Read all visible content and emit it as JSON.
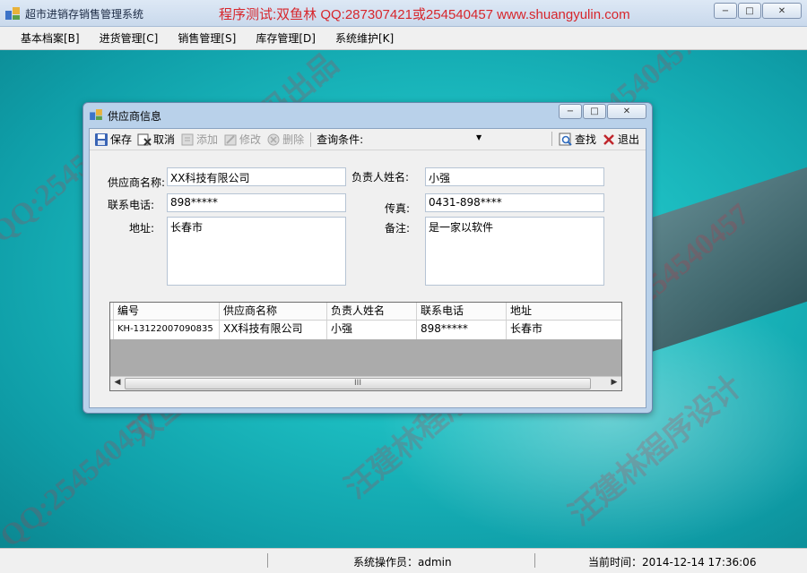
{
  "app": {
    "title": "超市进销存销售管理系统",
    "banner": "程序测试:双鱼林 QQ:287307421或254540457 www.shuangyulin.com",
    "window_buttons": {
      "minimize": "−",
      "maximize": "□",
      "close": "✕"
    }
  },
  "menu": {
    "items": [
      {
        "label": "基本档案[B]"
      },
      {
        "label": "进货管理[C]"
      },
      {
        "label": "销售管理[S]"
      },
      {
        "label": "库存管理[D]"
      },
      {
        "label": "系统维护[K]"
      }
    ]
  },
  "watermarks": [
    "QQ:254540457",
    "双鱼林源码出品",
    "汪建林程序设计",
    "QQ:254540457",
    "双鱼林源码出品",
    "汪建林程序设计",
    "QQ:254540457",
    "汪建林程序设计",
    "QQ:254540457"
  ],
  "dialog": {
    "title": "供应商信息",
    "toolbar": {
      "save": "保存",
      "cancel": "取消",
      "add": "添加",
      "edit": "修改",
      "delete": "删除",
      "query_label": "查询条件:",
      "query_value": "",
      "search": "查找",
      "exit": "退出"
    },
    "form": {
      "supplier_name_label": "供应商名称:",
      "supplier_name": "XX科技有限公司",
      "contact_name_label": "负责人姓名:",
      "contact_name": "小强",
      "phone_label": "联系电话:",
      "phone": "898*****",
      "fax_label": "传真:",
      "fax": "0431-898****",
      "address_label": "地址:",
      "address": "长春市",
      "remark_label": "备注:",
      "remark": "是一家以软件"
    },
    "grid": {
      "columns": [
        "编号",
        "供应商名称",
        "负责人姓名",
        "联系电话",
        "地址"
      ],
      "rows": [
        [
          "KH-13122007090835",
          "XX科技有限公司",
          "小强",
          "898*****",
          "长春市"
        ]
      ],
      "scroll_thumb": "III"
    }
  },
  "status": {
    "operator_label": "系统操作员：admin",
    "time_label": "当前时间：2014-12-14 17:36:06"
  },
  "colors": {
    "desktop": "#1cbcc0",
    "banner_red": "#d7262c",
    "window_frame": "#b9d1ea"
  },
  "icons": [
    "app-icon",
    "save-icon",
    "cancel-icon",
    "add-icon",
    "edit-icon",
    "delete-icon",
    "search-icon",
    "exit-icon"
  ]
}
